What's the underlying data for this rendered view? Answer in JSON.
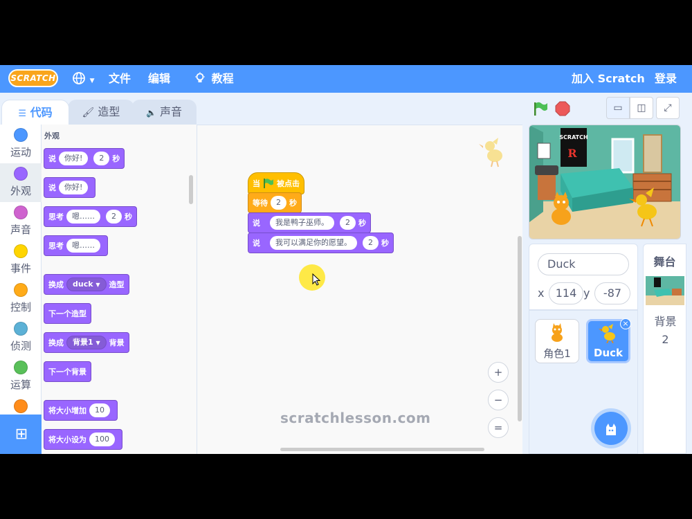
{
  "menubar": {
    "logo": "SCRATCH",
    "language_icon": "globe-icon",
    "file": "文件",
    "edit": "编辑",
    "tutorials": "教程",
    "join": "加入 Scratch",
    "signin": "登录"
  },
  "tabs": {
    "code": "代码",
    "costumes": "造型",
    "sounds": "声音"
  },
  "categories": [
    "运动",
    "外观",
    "声音",
    "事件",
    "控制",
    "侦测",
    "运算"
  ],
  "category_colors": [
    "#4c97ff",
    "#9966ff",
    "#cf63cf",
    "#ffd500",
    "#ffab19",
    "#5cb1d6",
    "#59c059"
  ],
  "palette": {
    "title": "外观",
    "blocks": {
      "say_for": {
        "say": "说",
        "text": "你好!",
        "secs": "2",
        "unit": "秒"
      },
      "say": {
        "say": "说",
        "text": "你好!"
      },
      "think_for": {
        "think": "思考",
        "text": "嗯……",
        "secs": "2",
        "unit": "秒"
      },
      "think": {
        "think": "思考",
        "text": "嗯……"
      },
      "switch_costume": {
        "pre": "换成",
        "value": "duck",
        "post": "造型"
      },
      "next_costume": "下一个造型",
      "switch_backdrop": {
        "pre": "换成",
        "value": "背景1",
        "post": "背景"
      },
      "next_backdrop": "下一个背景",
      "change_size": {
        "label": "将大小增加",
        "value": "10"
      },
      "set_size": {
        "label": "将大小设为",
        "value": "100"
      }
    }
  },
  "script": {
    "hat": {
      "pre": "当",
      "post": "被点击"
    },
    "wait": {
      "label": "等待",
      "secs": "2",
      "unit": "秒"
    },
    "say1": {
      "say": "说",
      "text": "我是鸭子巫师。",
      "secs": "2",
      "unit": "秒"
    },
    "say2": {
      "say": "说",
      "text": "我可以满足你的愿望。",
      "secs": "2",
      "unit": "秒"
    }
  },
  "watermark": "scratchlesson.com",
  "zoom": {
    "in": "+",
    "out": "−",
    "reset": "="
  },
  "sprite": {
    "name": "Duck",
    "x_label": "x",
    "x": "114",
    "y_label": "y",
    "y": "-87"
  },
  "sprites": [
    "角色1",
    "Duck"
  ],
  "stage_pane": {
    "title": "舞台",
    "backdrops_label": "背景",
    "backdrops_count": "2"
  },
  "stage_poster": "SCRATCH",
  "colors": {
    "accent": "#4c97ff",
    "looks": "#9966ff",
    "events": "#ffbf00",
    "control": "#ffab19"
  }
}
